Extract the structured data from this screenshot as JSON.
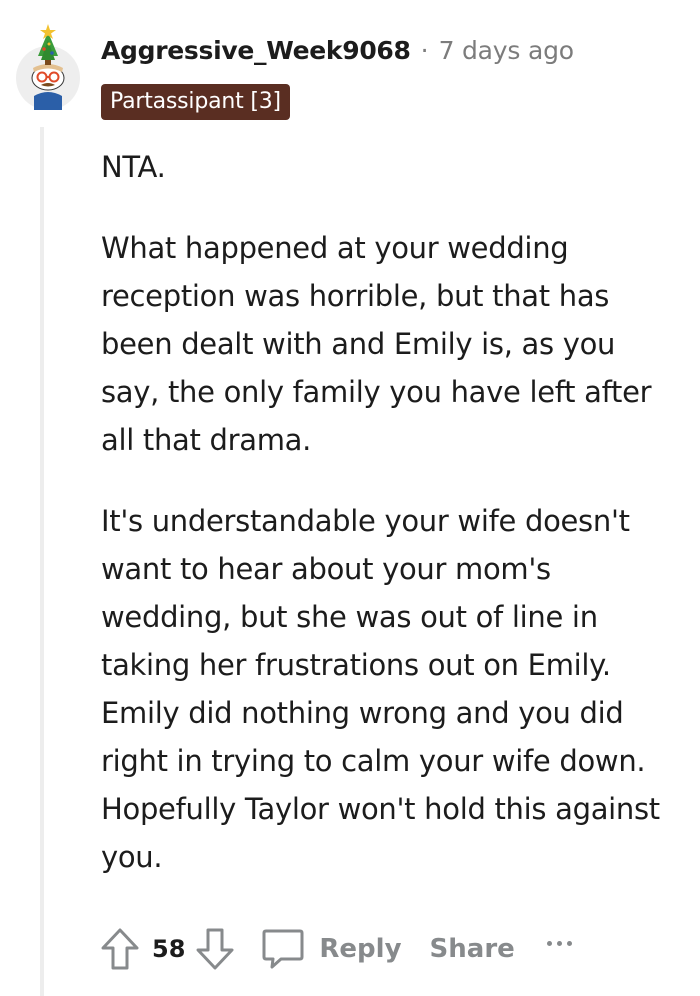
{
  "comment": {
    "username": "Aggressive_Week9068",
    "separator": "·",
    "timestamp": "7 days ago",
    "flair": "Partassipant [3]",
    "paragraphs": [
      "NTA.",
      "What happened at your wedding reception was horrible, but that has been dealt with and Emily is, as you say, the only family you have left after all that drama.",
      "It's understandable your wife doesn't want to hear about your mom's wedding, but she was out of line in taking her frustrations out on Emily. Emily did nothing wrong and you did right in trying to calm your wife down. Hopefully Taylor won't hold this against you."
    ]
  },
  "actions": {
    "vote_count": "58",
    "reply_label": "Reply",
    "share_label": "Share"
  },
  "icons": {
    "avatar": "snoo-avatar-with-christmas-tree-hat",
    "upvote": "upvote-arrow-icon",
    "downvote": "downvote-arrow-icon",
    "reply": "speech-bubble-icon",
    "more": "ellipsis-icon"
  },
  "colors": {
    "flair_bg": "#5a2e22",
    "flair_text": "#ffffff",
    "meta_text": "#7c7c7c",
    "action_text": "#878a8c",
    "thread_line": "#ededed"
  }
}
